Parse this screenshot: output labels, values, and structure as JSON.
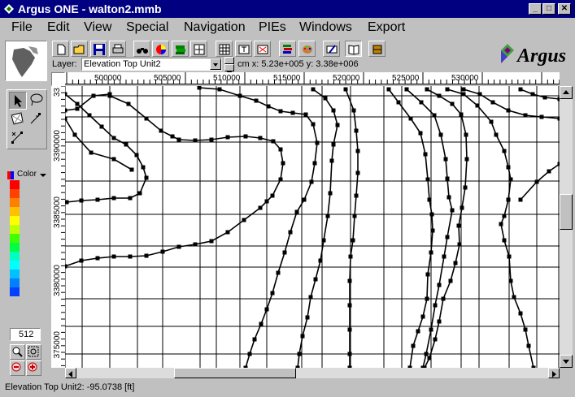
{
  "window": {
    "title": "Argus ONE - walton2.mmb",
    "controls": [
      "minimize",
      "maximize",
      "close"
    ]
  },
  "menu": [
    "File",
    "Edit",
    "View",
    "Special",
    "Navigation",
    "PIEs",
    "Windows",
    "Export"
  ],
  "toolbar": {
    "buttons": [
      "new-icon",
      "open-icon",
      "save-icon",
      "print-icon",
      "find-icon",
      "color-icon",
      "layers-icon",
      "zoom-extent-icon",
      "grid-icon",
      "text-icon",
      "delete-icon",
      "layer-stack-icon",
      "palette-icon",
      "edit-icon",
      "book-icon",
      "tool-icon"
    ],
    "layer_label": "Layer:",
    "layer_value": "Elevation Top Unit2",
    "coords": "cm x: 5.23e+005 y: 3.38e+006",
    "brand": "Argus"
  },
  "rulers": {
    "x_labels": [
      "500000",
      "505000",
      "510000",
      "515000",
      "520000",
      "525000",
      "530000"
    ],
    "y_labels": [
      "3390000",
      "3385000",
      "3380000",
      "375000"
    ],
    "y_partial": "33"
  },
  "tools": {
    "color_label": "Color",
    "zoom_value": "512",
    "palette": [
      "#ff0000",
      "#ff4000",
      "#ff8000",
      "#ffc000",
      "#ffff00",
      "#c0ff00",
      "#40ff00",
      "#00ff40",
      "#00ffc0",
      "#00ffff",
      "#00c0ff",
      "#0080ff",
      "#0040ff"
    ]
  },
  "status": {
    "text": "Elevation Top Unit2: -95.0738 [ft]"
  }
}
